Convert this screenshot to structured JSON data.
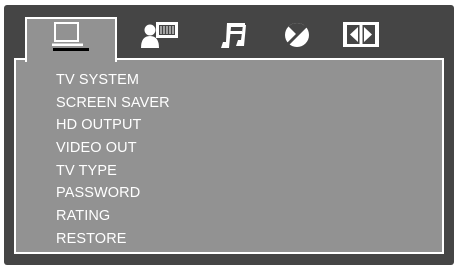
{
  "tabs": [
    {
      "icon": "tv-screen-icon",
      "active": true
    },
    {
      "icon": "user-speaker-icon",
      "active": false
    },
    {
      "icon": "music-note-icon",
      "active": false
    },
    {
      "icon": "prohibited-rating-icon",
      "active": false
    },
    {
      "icon": "split-screen-icon",
      "active": false
    }
  ],
  "menu": {
    "items": [
      "TV SYSTEM",
      "SCREEN SAVER",
      "HD OUTPUT",
      "VIDEO OUT",
      "TV TYPE",
      "PASSWORD",
      "RATING",
      "RESTORE"
    ]
  },
  "colors": {
    "background": "#454545",
    "panel": "#929292",
    "text": "#ffffff",
    "icon": "#ffffff",
    "border": "#ffffff"
  }
}
